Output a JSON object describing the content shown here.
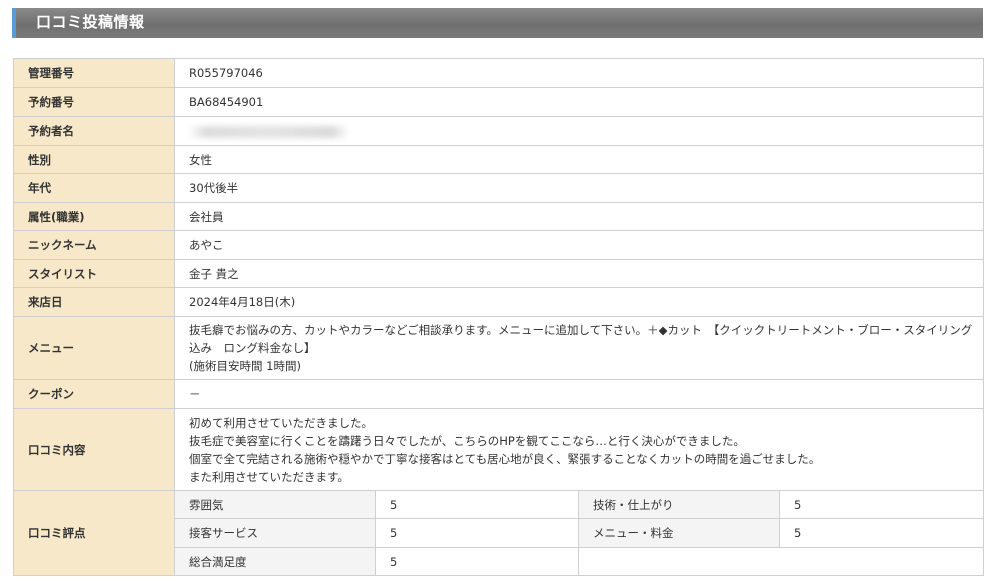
{
  "section": {
    "title": "口コミ投稿情報"
  },
  "fields": {
    "admin_no": {
      "label": "管理番号",
      "value": "R055797046"
    },
    "reserve_no": {
      "label": "予約番号",
      "value": "BA68454901"
    },
    "reserver": {
      "label": "予約者名"
    },
    "gender": {
      "label": "性別",
      "value": "女性"
    },
    "age": {
      "label": "年代",
      "value": "30代後半"
    },
    "attribute": {
      "label": "属性(職業)",
      "value": "会社員"
    },
    "nickname": {
      "label": "ニックネーム",
      "value": "あやこ"
    },
    "stylist": {
      "label": "スタイリスト",
      "value": "金子 貴之"
    },
    "visit_date": {
      "label": "来店日",
      "value": "2024年4月18日(木)"
    },
    "menu": {
      "label": "メニュー",
      "line1": "抜毛癖でお悩みの方、カットやカラーなどご相談承ります。メニューに追加して下さい。＋◆カット　【クイックトリートメント・ブロー・スタイリング込み　ロング料金なし】",
      "line2": "(施術目安時間 1時間)"
    },
    "coupon": {
      "label": "クーポン",
      "value": "－"
    },
    "review": {
      "label": "口コミ内容",
      "lines": [
        "初めて利用させていただきました。",
        "抜毛症で美容室に行くことを躊躇う日々でしたが、こちらのHPを観てここなら…と行く決心ができました。",
        "個室で全て完結される施術や穏やかで丁寧な接客はとても居心地が良く、緊張することなくカットの時間を過ごせました。",
        "また利用させていただきます。"
      ]
    },
    "rating": {
      "label": "口コミ評点",
      "atmosphere": {
        "label": "雰囲気",
        "value": "5"
      },
      "technique": {
        "label": "技術・仕上がり",
        "value": "5"
      },
      "service": {
        "label": "接客サービス",
        "value": "5"
      },
      "menu_price": {
        "label": "メニュー・料金",
        "value": "5"
      },
      "overall": {
        "label": "総合満足度",
        "value": "5"
      }
    }
  }
}
